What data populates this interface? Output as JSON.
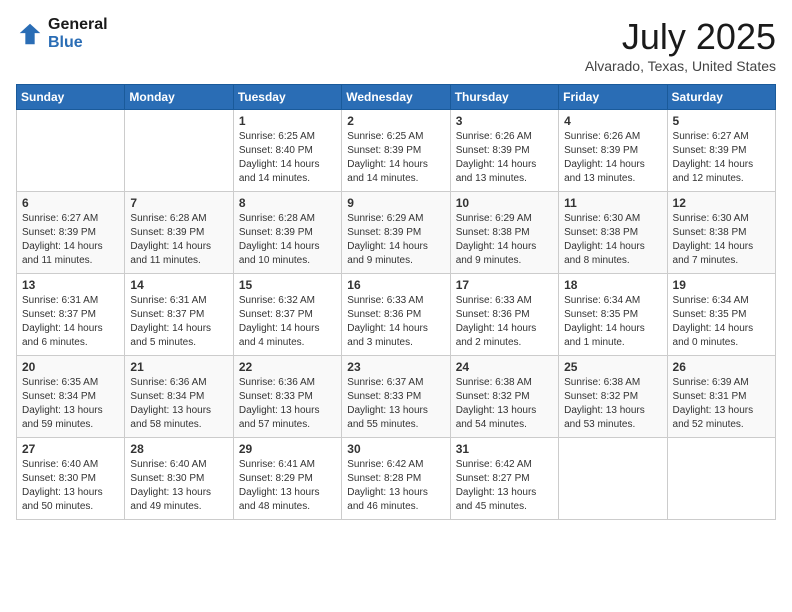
{
  "header": {
    "logo_line1": "General",
    "logo_line2": "Blue",
    "month": "July 2025",
    "location": "Alvarado, Texas, United States"
  },
  "weekdays": [
    "Sunday",
    "Monday",
    "Tuesday",
    "Wednesday",
    "Thursday",
    "Friday",
    "Saturday"
  ],
  "weeks": [
    [
      {
        "num": "",
        "info": ""
      },
      {
        "num": "",
        "info": ""
      },
      {
        "num": "1",
        "info": "Sunrise: 6:25 AM\nSunset: 8:40 PM\nDaylight: 14 hours and 14 minutes."
      },
      {
        "num": "2",
        "info": "Sunrise: 6:25 AM\nSunset: 8:39 PM\nDaylight: 14 hours and 14 minutes."
      },
      {
        "num": "3",
        "info": "Sunrise: 6:26 AM\nSunset: 8:39 PM\nDaylight: 14 hours and 13 minutes."
      },
      {
        "num": "4",
        "info": "Sunrise: 6:26 AM\nSunset: 8:39 PM\nDaylight: 14 hours and 13 minutes."
      },
      {
        "num": "5",
        "info": "Sunrise: 6:27 AM\nSunset: 8:39 PM\nDaylight: 14 hours and 12 minutes."
      }
    ],
    [
      {
        "num": "6",
        "info": "Sunrise: 6:27 AM\nSunset: 8:39 PM\nDaylight: 14 hours and 11 minutes."
      },
      {
        "num": "7",
        "info": "Sunrise: 6:28 AM\nSunset: 8:39 PM\nDaylight: 14 hours and 11 minutes."
      },
      {
        "num": "8",
        "info": "Sunrise: 6:28 AM\nSunset: 8:39 PM\nDaylight: 14 hours and 10 minutes."
      },
      {
        "num": "9",
        "info": "Sunrise: 6:29 AM\nSunset: 8:39 PM\nDaylight: 14 hours and 9 minutes."
      },
      {
        "num": "10",
        "info": "Sunrise: 6:29 AM\nSunset: 8:38 PM\nDaylight: 14 hours and 9 minutes."
      },
      {
        "num": "11",
        "info": "Sunrise: 6:30 AM\nSunset: 8:38 PM\nDaylight: 14 hours and 8 minutes."
      },
      {
        "num": "12",
        "info": "Sunrise: 6:30 AM\nSunset: 8:38 PM\nDaylight: 14 hours and 7 minutes."
      }
    ],
    [
      {
        "num": "13",
        "info": "Sunrise: 6:31 AM\nSunset: 8:37 PM\nDaylight: 14 hours and 6 minutes."
      },
      {
        "num": "14",
        "info": "Sunrise: 6:31 AM\nSunset: 8:37 PM\nDaylight: 14 hours and 5 minutes."
      },
      {
        "num": "15",
        "info": "Sunrise: 6:32 AM\nSunset: 8:37 PM\nDaylight: 14 hours and 4 minutes."
      },
      {
        "num": "16",
        "info": "Sunrise: 6:33 AM\nSunset: 8:36 PM\nDaylight: 14 hours and 3 minutes."
      },
      {
        "num": "17",
        "info": "Sunrise: 6:33 AM\nSunset: 8:36 PM\nDaylight: 14 hours and 2 minutes."
      },
      {
        "num": "18",
        "info": "Sunrise: 6:34 AM\nSunset: 8:35 PM\nDaylight: 14 hours and 1 minute."
      },
      {
        "num": "19",
        "info": "Sunrise: 6:34 AM\nSunset: 8:35 PM\nDaylight: 14 hours and 0 minutes."
      }
    ],
    [
      {
        "num": "20",
        "info": "Sunrise: 6:35 AM\nSunset: 8:34 PM\nDaylight: 13 hours and 59 minutes."
      },
      {
        "num": "21",
        "info": "Sunrise: 6:36 AM\nSunset: 8:34 PM\nDaylight: 13 hours and 58 minutes."
      },
      {
        "num": "22",
        "info": "Sunrise: 6:36 AM\nSunset: 8:33 PM\nDaylight: 13 hours and 57 minutes."
      },
      {
        "num": "23",
        "info": "Sunrise: 6:37 AM\nSunset: 8:33 PM\nDaylight: 13 hours and 55 minutes."
      },
      {
        "num": "24",
        "info": "Sunrise: 6:38 AM\nSunset: 8:32 PM\nDaylight: 13 hours and 54 minutes."
      },
      {
        "num": "25",
        "info": "Sunrise: 6:38 AM\nSunset: 8:32 PM\nDaylight: 13 hours and 53 minutes."
      },
      {
        "num": "26",
        "info": "Sunrise: 6:39 AM\nSunset: 8:31 PM\nDaylight: 13 hours and 52 minutes."
      }
    ],
    [
      {
        "num": "27",
        "info": "Sunrise: 6:40 AM\nSunset: 8:30 PM\nDaylight: 13 hours and 50 minutes."
      },
      {
        "num": "28",
        "info": "Sunrise: 6:40 AM\nSunset: 8:30 PM\nDaylight: 13 hours and 49 minutes."
      },
      {
        "num": "29",
        "info": "Sunrise: 6:41 AM\nSunset: 8:29 PM\nDaylight: 13 hours and 48 minutes."
      },
      {
        "num": "30",
        "info": "Sunrise: 6:42 AM\nSunset: 8:28 PM\nDaylight: 13 hours and 46 minutes."
      },
      {
        "num": "31",
        "info": "Sunrise: 6:42 AM\nSunset: 8:27 PM\nDaylight: 13 hours and 45 minutes."
      },
      {
        "num": "",
        "info": ""
      },
      {
        "num": "",
        "info": ""
      }
    ]
  ]
}
